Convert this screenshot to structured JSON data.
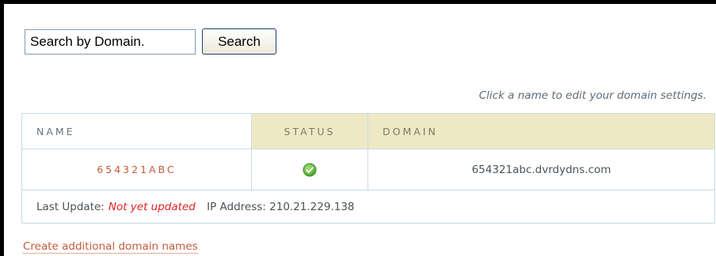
{
  "search": {
    "value": "Search by Domain.",
    "button_label": "Search"
  },
  "hint": "Click a name to edit your domain settings.",
  "table": {
    "headers": {
      "name": "NAME",
      "status": "STATUS",
      "domain": "DOMAIN"
    },
    "row": {
      "name": "654321ABC",
      "status_icon": "check-circle-icon",
      "domain": "654321abc.dvrdydns.com"
    },
    "info": {
      "last_update_label": "Last Update:",
      "last_update_value": "Not yet updated",
      "ip_label": "IP Address:",
      "ip_value": "210.21.229.138"
    }
  },
  "create_link": "Create additional domain names",
  "colors": {
    "link": "#c45a3b",
    "header_highlight": "#eee9c4",
    "status_ok": "#6cbe45",
    "warning": "#e02222"
  }
}
